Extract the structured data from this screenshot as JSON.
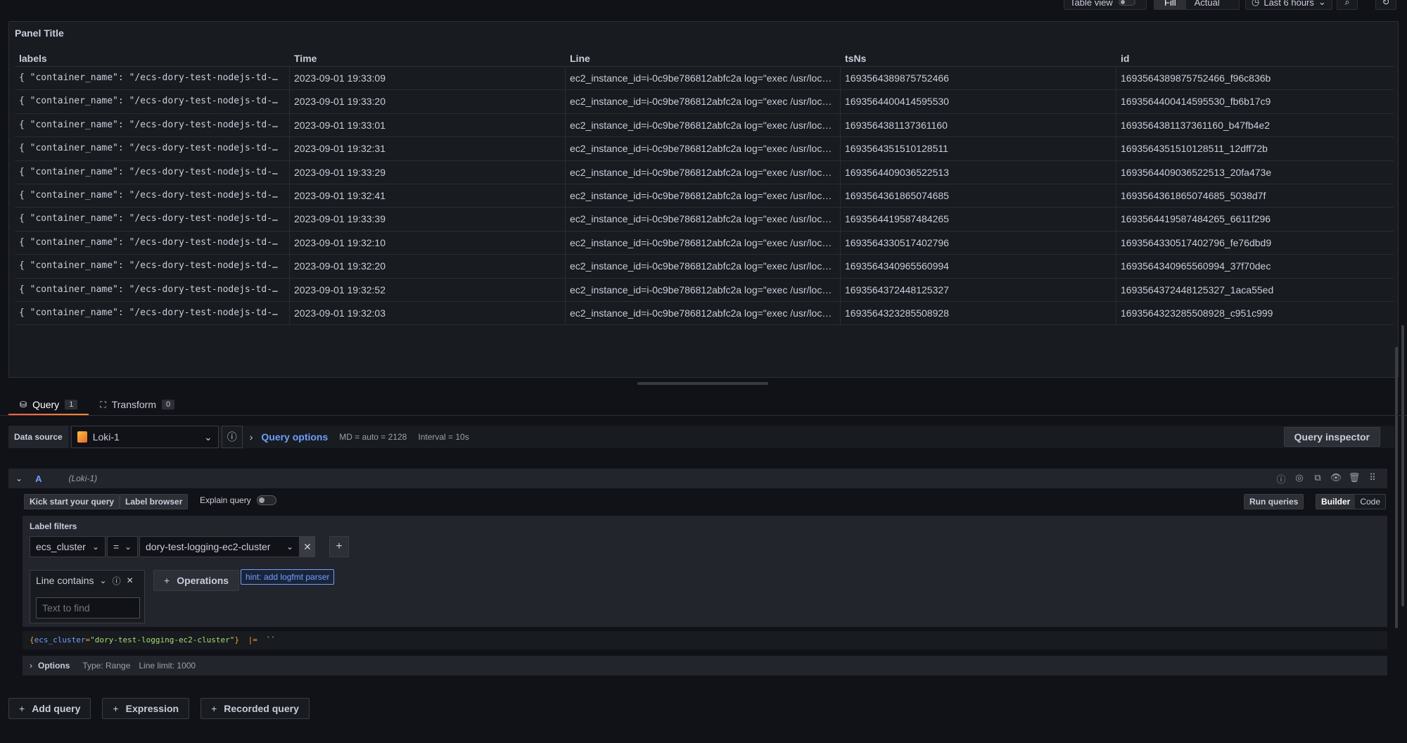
{
  "top": {
    "table_view_label": "Table view",
    "fill_label": "Fill",
    "actual_label": "Actual",
    "time_range": "Last 6 hours"
  },
  "panel": {
    "title": "Panel Title",
    "columns": [
      "labels",
      "Time",
      "Line",
      "tsNs",
      "id"
    ],
    "rows": [
      [
        "{ \"container_name\": \"/ecs-dory-test-nodejs-td-…",
        "2023-09-01 19:33:09",
        "ec2_instance_id=i-0c9be786812abfc2a log=\"exec /usr/loc…",
        "1693564389875752466",
        "1693564389875752466_f96c836b"
      ],
      [
        "{ \"container_name\": \"/ecs-dory-test-nodejs-td-…",
        "2023-09-01 19:33:20",
        "ec2_instance_id=i-0c9be786812abfc2a log=\"exec /usr/loc…",
        "1693564400414595530",
        "1693564400414595530_fb6b17c9"
      ],
      [
        "{ \"container_name\": \"/ecs-dory-test-nodejs-td-…",
        "2023-09-01 19:33:01",
        "ec2_instance_id=i-0c9be786812abfc2a log=\"exec /usr/loc…",
        "1693564381137361160",
        "1693564381137361160_b47fb4e2"
      ],
      [
        "{ \"container_name\": \"/ecs-dory-test-nodejs-td-…",
        "2023-09-01 19:32:31",
        "ec2_instance_id=i-0c9be786812abfc2a log=\"exec /usr/loc…",
        "1693564351510128511",
        "1693564351510128511_12dff72b"
      ],
      [
        "{ \"container_name\": \"/ecs-dory-test-nodejs-td-…",
        "2023-09-01 19:33:29",
        "ec2_instance_id=i-0c9be786812abfc2a log=\"exec /usr/loc…",
        "1693564409036522513",
        "1693564409036522513_20fa473e"
      ],
      [
        "{ \"container_name\": \"/ecs-dory-test-nodejs-td-…",
        "2023-09-01 19:32:41",
        "ec2_instance_id=i-0c9be786812abfc2a log=\"exec /usr/loc…",
        "1693564361865074685",
        "1693564361865074685_5038d7f"
      ],
      [
        "{ \"container_name\": \"/ecs-dory-test-nodejs-td-…",
        "2023-09-01 19:33:39",
        "ec2_instance_id=i-0c9be786812abfc2a log=\"exec /usr/loc…",
        "1693564419587484265",
        "1693564419587484265_6611f296"
      ],
      [
        "{ \"container_name\": \"/ecs-dory-test-nodejs-td-…",
        "2023-09-01 19:32:10",
        "ec2_instance_id=i-0c9be786812abfc2a log=\"exec /usr/loc…",
        "1693564330517402796",
        "1693564330517402796_fe76dbd9"
      ],
      [
        "{ \"container_name\": \"/ecs-dory-test-nodejs-td-…",
        "2023-09-01 19:32:20",
        "ec2_instance_id=i-0c9be786812abfc2a log=\"exec /usr/loc…",
        "1693564340965560994",
        "1693564340965560994_37f70dec"
      ],
      [
        "{ \"container_name\": \"/ecs-dory-test-nodejs-td-…",
        "2023-09-01 19:32:52",
        "ec2_instance_id=i-0c9be786812abfc2a log=\"exec /usr/loc…",
        "1693564372448125327",
        "1693564372448125327_1aca55ed"
      ],
      [
        "{ \"container_name\": \"/ecs-dory-test-nodejs-td-…",
        "2023-09-01 19:32:03",
        "ec2_instance_id=i-0c9be786812abfc2a log=\"exec /usr/loc…",
        "1693564323285508928",
        "1693564323285508928_c951c999"
      ]
    ]
  },
  "tabs": [
    {
      "label": "Query",
      "count": "1"
    },
    {
      "label": "Transform",
      "count": "0"
    }
  ],
  "datasource": {
    "label": "Data source",
    "value": "Loki-1",
    "query_options": "Query options",
    "md": "MD = auto = 2128",
    "interval": "Interval = 10s",
    "inspector": "Query inspector"
  },
  "query": {
    "letter": "A",
    "ds_name": "(Loki-1)",
    "kick_start": "Kick start your query",
    "label_browser": "Label browser",
    "explain": "Explain query",
    "run": "Run queries",
    "builder": "Builder",
    "code": "Code",
    "label_filters": "Label filters",
    "filter_key": "ecs_cluster",
    "filter_op": "=",
    "filter_value": "dory-test-logging-ec2-cluster",
    "line_contains": "Line contains",
    "text_placeholder": "Text to find",
    "operations": "Operations",
    "hint": "hint: add logfmt parser",
    "raw_open": "{",
    "raw_key": "ecs_cluster",
    "raw_eq": "=",
    "raw_val": "\"dory-test-logging-ec2-cluster\"",
    "raw_close": "}",
    "raw_pipe": "|=",
    "raw_ticks": "``",
    "options": "Options",
    "type": "Type: Range",
    "limit": "Line limit: 1000"
  },
  "bottom": {
    "add_query": "Add query",
    "expression": "Expression",
    "recorded": "Recorded query"
  }
}
